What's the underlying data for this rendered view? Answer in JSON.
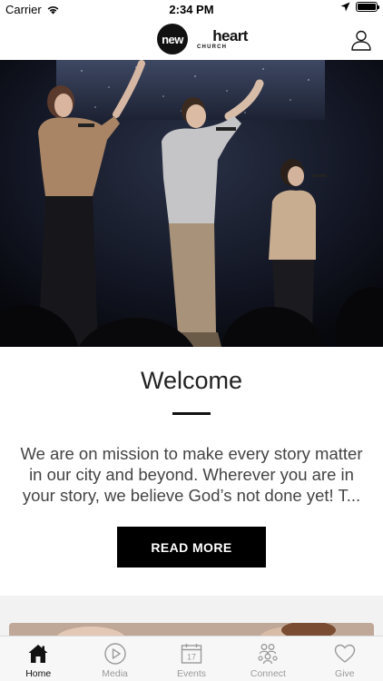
{
  "status_bar": {
    "carrier": "Carrier",
    "time": "2:34 PM"
  },
  "header": {
    "logo_main": "newheart",
    "logo_sub": "CHURCH"
  },
  "welcome": {
    "title": "Welcome",
    "body": "We are on mission to make every story matter in our city and beyond. Wherever you are in your story, we believe God’s not done yet! T...",
    "button_label": "READ MORE"
  },
  "tab_bar": {
    "tabs": [
      {
        "label": "Home",
        "icon": "home-icon",
        "active": true
      },
      {
        "label": "Media",
        "icon": "play-circle-icon",
        "active": false
      },
      {
        "label": "Events",
        "icon": "calendar-icon",
        "active": false
      },
      {
        "label": "Connect",
        "icon": "people-icon",
        "active": false
      },
      {
        "label": "Give",
        "icon": "heart-icon",
        "active": false
      }
    ],
    "calendar_day": "17"
  },
  "colors": {
    "accent": "#000000",
    "inactive_tab": "#9a9a9a",
    "background": "#ffffff"
  }
}
